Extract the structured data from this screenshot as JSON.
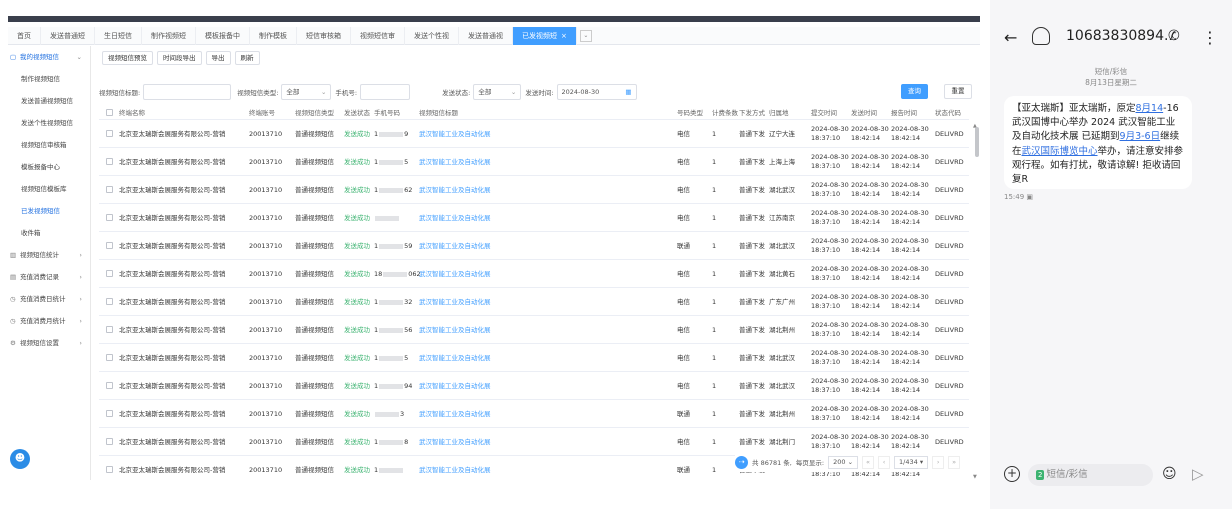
{
  "tabs": [
    {
      "label": "首页"
    },
    {
      "label": "发送普通短"
    },
    {
      "label": "生日短信"
    },
    {
      "label": "制作视频短"
    },
    {
      "label": "模板报备中"
    },
    {
      "label": "制作模板"
    },
    {
      "label": "短信审核箱"
    },
    {
      "label": "视频短信审"
    },
    {
      "label": "发送个性视"
    },
    {
      "label": "发送普通视"
    },
    {
      "label": "已发视频短",
      "active": true,
      "close": "×"
    }
  ],
  "tab_more": "⌄",
  "sidebar": [
    {
      "label": "我的视频短信",
      "icon": "▢",
      "arrow": "⌄",
      "kind": "parent"
    },
    {
      "label": "制作视频短信"
    },
    {
      "label": "发送普通视频短信"
    },
    {
      "label": "发送个性视频短信"
    },
    {
      "label": "视频短信审核箱"
    },
    {
      "label": "模板报备中心"
    },
    {
      "label": "视频短信模板库"
    },
    {
      "label": "已发视频短信",
      "active": true
    },
    {
      "label": "收件箱"
    },
    {
      "label": "视频短信统计",
      "icon": "▥",
      "arrow": "›",
      "kind": "grp"
    },
    {
      "label": "充值消费记录",
      "icon": "▤",
      "arrow": "›",
      "kind": "grp"
    },
    {
      "label": "充值消费日统计",
      "icon": "◷",
      "arrow": "›",
      "kind": "grp"
    },
    {
      "label": "充值消费月统计",
      "icon": "◷",
      "arrow": "›",
      "kind": "grp"
    },
    {
      "label": "视频短信设置",
      "icon": "⚙",
      "arrow": "›",
      "kind": "grp"
    }
  ],
  "help_icon": "☻",
  "buttons": {
    "preview": "视频短信预览",
    "export_range": "时间段导出",
    "export": "导出",
    "refresh": "刷新"
  },
  "filters": {
    "title_label": "视频短信标题:",
    "title_value": "",
    "type_label": "视频短信类型:",
    "type_value": "全部",
    "phone_label": "手机号:",
    "phone_value": "",
    "status_label": "发送状态:",
    "status_value": "全部",
    "time_label": "发送时间:",
    "time_value": "2024-08-30",
    "query": "查询",
    "reset": "重置",
    "dropdown_icon": "⌄",
    "calendar_icon": "▦"
  },
  "table": {
    "headers": [
      "终端名称",
      "终端账号",
      "视频短信类型",
      "发送状态",
      "手机号码",
      "视频短信标题",
      "号码类型",
      "计费条数",
      "下发方式",
      "归属地",
      "提交时间",
      "发送时间",
      "报告时间",
      "状态代码"
    ],
    "rows": [
      {
        "terminal": "北京亚太瑞斯会展服务有限公司-营销",
        "account": "20013710",
        "type": "普通视频短信",
        "status": "发送成功",
        "phone_a": "1",
        "phone_b": "9",
        "title": "武汉智能工业及自动化展",
        "carrier": "电信",
        "count": "1",
        "method": "普通下发",
        "region": "辽宁大连",
        "submit_d": "2024-08-30",
        "submit_t": "18:37:10",
        "send_d": "2024-08-30",
        "send_t": "18:42:14",
        "report_d": "2024-08-30",
        "report_t": "18:42:14",
        "code": "DELIVRD"
      },
      {
        "terminal": "北京亚太瑞斯会展服务有限公司-营销",
        "account": "20013710",
        "type": "普通视频短信",
        "status": "发送成功",
        "phone_a": "1",
        "phone_b": "5",
        "title": "武汉智能工业及自动化展",
        "carrier": "电信",
        "count": "1",
        "method": "普通下发",
        "region": "上海上海",
        "submit_d": "2024-08-30",
        "submit_t": "18:37:10",
        "send_d": "2024-08-30",
        "send_t": "18:42:14",
        "report_d": "2024-08-30",
        "report_t": "18:42:14",
        "code": "DELIVRD"
      },
      {
        "terminal": "北京亚太瑞斯会展服务有限公司-营销",
        "account": "20013710",
        "type": "普通视频短信",
        "status": "发送成功",
        "phone_a": "1",
        "phone_b": "62",
        "title": "武汉智能工业及自动化展",
        "carrier": "电信",
        "count": "1",
        "method": "普通下发",
        "region": "湖北武汉",
        "submit_d": "2024-08-30",
        "submit_t": "18:37:10",
        "send_d": "2024-08-30",
        "send_t": "18:42:14",
        "report_d": "2024-08-30",
        "report_t": "18:42:14",
        "code": "DELIVRD"
      },
      {
        "terminal": "北京亚太瑞斯会展服务有限公司-营销",
        "account": "20013710",
        "type": "普通视频短信",
        "status": "发送成功",
        "phone_a": "",
        "phone_b": "",
        "title": "武汉智能工业及自动化展",
        "carrier": "电信",
        "count": "1",
        "method": "普通下发",
        "region": "江苏南京",
        "submit_d": "2024-08-30",
        "submit_t": "18:37:10",
        "send_d": "2024-08-30",
        "send_t": "18:42:14",
        "report_d": "2024-08-30",
        "report_t": "18:42:14",
        "code": "DELIVRD"
      },
      {
        "terminal": "北京亚太瑞斯会展服务有限公司-营销",
        "account": "20013710",
        "type": "普通视频短信",
        "status": "发送成功",
        "phone_a": "1",
        "phone_b": "59",
        "title": "武汉智能工业及自动化展",
        "carrier": "联通",
        "count": "1",
        "method": "普通下发",
        "region": "湖北武汉",
        "submit_d": "2024-08-30",
        "submit_t": "18:37:10",
        "send_d": "2024-08-30",
        "send_t": "18:42:14",
        "report_d": "2024-08-30",
        "report_t": "18:42:14",
        "code": "DELIVRD"
      },
      {
        "terminal": "北京亚太瑞斯会展服务有限公司-营销",
        "account": "20013710",
        "type": "普通视频短信",
        "status": "发送成功",
        "phone_a": "18",
        "phone_b": "062",
        "title": "武汉智能工业及自动化展",
        "carrier": "电信",
        "count": "1",
        "method": "普通下发",
        "region": "湖北黄石",
        "submit_d": "2024-08-30",
        "submit_t": "18:37:10",
        "send_d": "2024-08-30",
        "send_t": "18:42:14",
        "report_d": "2024-08-30",
        "report_t": "18:42:14",
        "code": "DELIVRD"
      },
      {
        "terminal": "北京亚太瑞斯会展服务有限公司-营销",
        "account": "20013710",
        "type": "普通视频短信",
        "status": "发送成功",
        "phone_a": "1",
        "phone_b": "32",
        "title": "武汉智能工业及自动化展",
        "carrier": "电信",
        "count": "1",
        "method": "普通下发",
        "region": "广东广州",
        "submit_d": "2024-08-30",
        "submit_t": "18:37:10",
        "send_d": "2024-08-30",
        "send_t": "18:42:14",
        "report_d": "2024-08-30",
        "report_t": "18:42:14",
        "code": "DELIVRD"
      },
      {
        "terminal": "北京亚太瑞斯会展服务有限公司-营销",
        "account": "20013710",
        "type": "普通视频短信",
        "status": "发送成功",
        "phone_a": "1",
        "phone_b": "56",
        "title": "武汉智能工业及自动化展",
        "carrier": "电信",
        "count": "1",
        "method": "普通下发",
        "region": "湖北荆州",
        "submit_d": "2024-08-30",
        "submit_t": "18:37:10",
        "send_d": "2024-08-30",
        "send_t": "18:42:14",
        "report_d": "2024-08-30",
        "report_t": "18:42:14",
        "code": "DELIVRD"
      },
      {
        "terminal": "北京亚太瑞斯会展服务有限公司-营销",
        "account": "20013710",
        "type": "普通视频短信",
        "status": "发送成功",
        "phone_a": "1",
        "phone_b": "5",
        "title": "武汉智能工业及自动化展",
        "carrier": "电信",
        "count": "1",
        "method": "普通下发",
        "region": "湖北武汉",
        "submit_d": "2024-08-30",
        "submit_t": "18:37:10",
        "send_d": "2024-08-30",
        "send_t": "18:42:14",
        "report_d": "2024-08-30",
        "report_t": "18:42:14",
        "code": "DELIVRD"
      },
      {
        "terminal": "北京亚太瑞斯会展服务有限公司-营销",
        "account": "20013710",
        "type": "普通视频短信",
        "status": "发送成功",
        "phone_a": "1",
        "phone_b": "94",
        "title": "武汉智能工业及自动化展",
        "carrier": "电信",
        "count": "1",
        "method": "普通下发",
        "region": "湖北武汉",
        "submit_d": "2024-08-30",
        "submit_t": "18:37:10",
        "send_d": "2024-08-30",
        "send_t": "18:42:14",
        "report_d": "2024-08-30",
        "report_t": "18:42:14",
        "code": "DELIVRD"
      },
      {
        "terminal": "北京亚太瑞斯会展服务有限公司-营销",
        "account": "20013710",
        "type": "普通视频短信",
        "status": "发送成功",
        "phone_a": "",
        "phone_b": "3",
        "title": "武汉智能工业及自动化展",
        "carrier": "联通",
        "count": "1",
        "method": "普通下发",
        "region": "湖北荆州",
        "submit_d": "2024-08-30",
        "submit_t": "18:37:10",
        "send_d": "2024-08-30",
        "send_t": "18:42:14",
        "report_d": "2024-08-30",
        "report_t": "18:42:14",
        "code": "DELIVRD"
      },
      {
        "terminal": "北京亚太瑞斯会展服务有限公司-营销",
        "account": "20013710",
        "type": "普通视频短信",
        "status": "发送成功",
        "phone_a": "1",
        "phone_b": "8",
        "title": "武汉智能工业及自动化展",
        "carrier": "电信",
        "count": "1",
        "method": "普通下发",
        "region": "湖北荆门",
        "submit_d": "2024-08-30",
        "submit_t": "18:37:10",
        "send_d": "2024-08-30",
        "send_t": "18:42:14",
        "report_d": "2024-08-30",
        "report_t": "18:42:14",
        "code": "DELIVRD"
      },
      {
        "terminal": "北京亚太瑞斯会展服务有限公司-营销",
        "account": "20013710",
        "type": "普通视频短信",
        "status": "发送成功",
        "phone_a": "1",
        "phone_b": "",
        "title": "武汉智能工业及自动化展",
        "carrier": "联通",
        "count": "1",
        "method": "普通下发",
        "region": "",
        "submit_d": "2024-08-30",
        "submit_t": "18:37:10",
        "send_d": "2024-08-30",
        "send_t": "18:42:14",
        "report_d": "2024-08-30",
        "report_t": "18:42:14",
        "code": "DELIVRD"
      }
    ]
  },
  "pager": {
    "icon": "⇢",
    "total": "共 86781 条,",
    "per_page_label": "每页显示:",
    "per_page": "200",
    "per_page_arrow": "⌄",
    "first": "«",
    "prev": "‹",
    "page": "1/434",
    "page_arrow": "▾",
    "next": "›",
    "last": "»"
  },
  "phone": {
    "back": "←",
    "bell": "",
    "number": "10683830894...",
    "call": "✆",
    "more": "⋮",
    "meta_type": "短信/彩信",
    "meta_date": "8月13日星期二",
    "msg": {
      "p1": "【亚太瑞斯】亚太瑞斯，原定",
      "l1": "8月14",
      "p2": "-16武汉国博中心举办 2024 武汉智能工业及自动化技术展 已延期到",
      "l2": "9月3-6日",
      "p3": "继续在",
      "l3": "武汉国际博览中心",
      "p4": "举办，请注意安排参观行程。如有打扰，敬请谅解! 拒收请回复R"
    },
    "time": "15:49 ▣",
    "input_placeholder": "短信/彩信",
    "sim": "2",
    "plus": "+",
    "emoji": "☺",
    "send": "▷"
  }
}
